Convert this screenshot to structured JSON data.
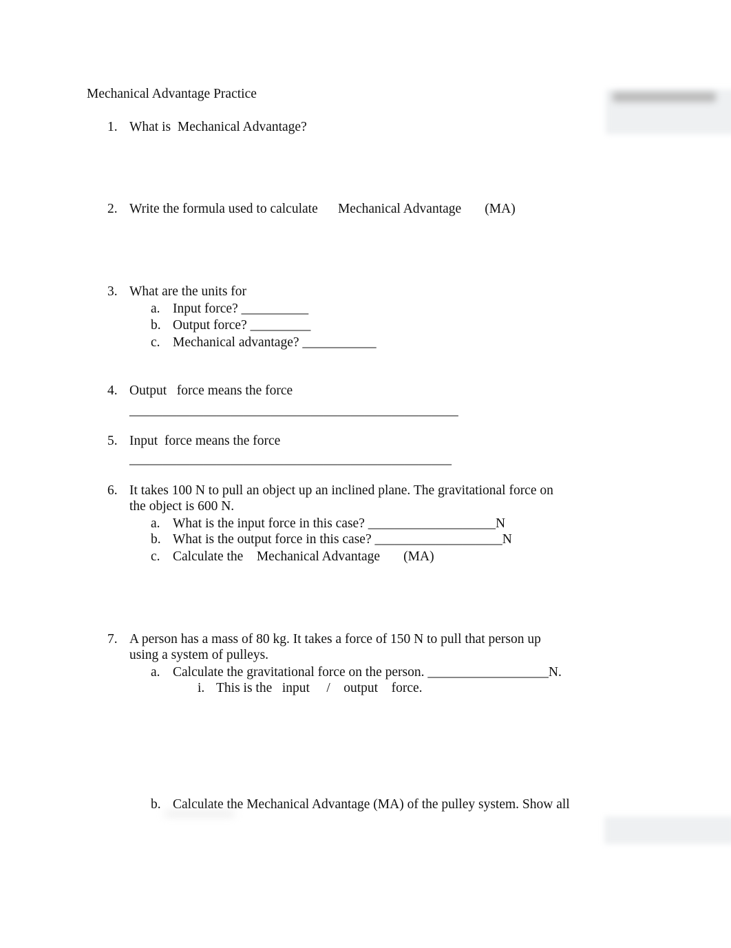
{
  "document": {
    "title": "Mechanical Advantage Practice",
    "questions": [
      {
        "num": "1.",
        "lines": [
          "What is  Mechanical Advantage?"
        ]
      },
      {
        "num": "2.",
        "lines": [
          "Write the formula used to calculate      Mechanical Advantage       (MA)"
        ]
      },
      {
        "num": "3.",
        "lines": [
          "What are the units for"
        ],
        "sub": [
          {
            "label": "a.",
            "text": "Input force? __________"
          },
          {
            "label": "b.",
            "text": "Output force? _________"
          },
          {
            "label": "c.",
            "text": "Mechanical advantage? ___________"
          }
        ]
      },
      {
        "num": "4.",
        "lines": [
          "Output   force means the force",
          "_________________________________________________"
        ]
      },
      {
        "num": "5.",
        "lines": [
          "Input  force means the force",
          "________________________________________________"
        ]
      },
      {
        "num": "6.",
        "lines": [
          "It takes 100 N to pull an object up an inclined plane. The gravitational force on",
          "the object is 600 N."
        ],
        "sub": [
          {
            "label": "a.",
            "text": "What is the input force in this case? ___________________N"
          },
          {
            "label": "b.",
            "text": "What is the output force in this case? ___________________N"
          },
          {
            "label": "c.",
            "text": "Calculate the    Mechanical Advantage       (MA)"
          }
        ]
      },
      {
        "num": "7.",
        "lines": [
          "A person has a mass of 80 kg. It takes a force of 150 N to pull that person up",
          "using a system of pulleys."
        ],
        "sub": [
          {
            "label": "a.",
            "text": "Calculate the gravitational force on the person. __________________N."
          },
          {
            "label": "b.",
            "text": "Calculate the Mechanical Advantage (MA) of the pulley system. Show all"
          }
        ],
        "subsub": [
          {
            "label": "i.",
            "text": "This is the   input     /    output    force."
          }
        ]
      }
    ]
  }
}
